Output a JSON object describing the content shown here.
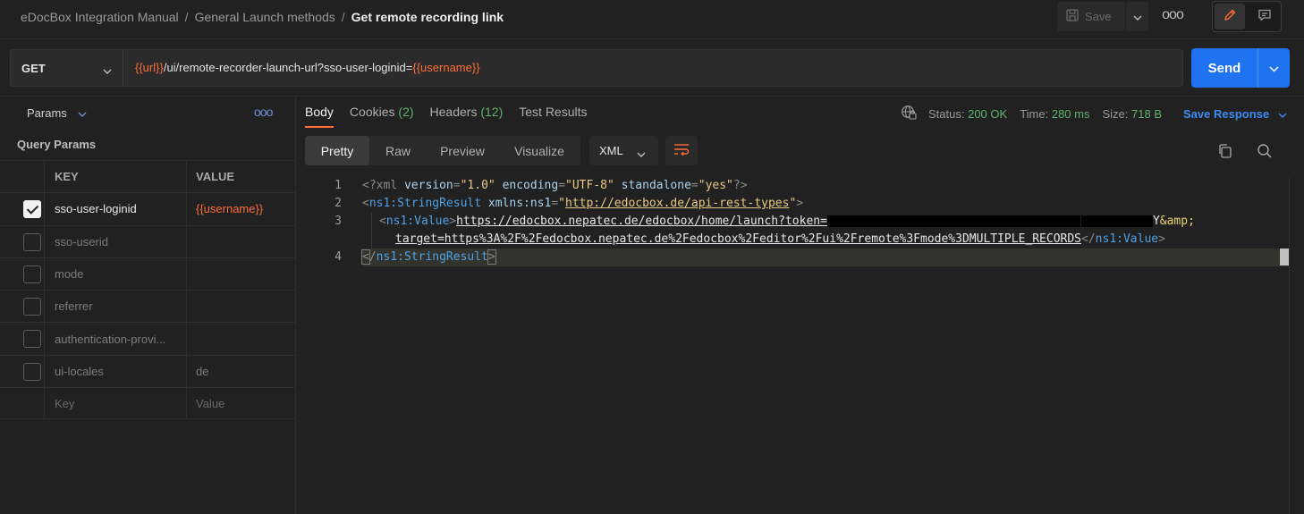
{
  "breadcrumb": {
    "items": [
      "eDocBox Integration Manual",
      "General Launch methods"
    ],
    "current": "Get remote recording link",
    "separator": "/"
  },
  "toolbar": {
    "save_label": "Save",
    "more_label": "ooo"
  },
  "request": {
    "method": "GET",
    "url_var1": "{{url}}",
    "url_path": "/ui/remote-recorder-launch-url?sso-user-loginid=",
    "url_var2": "{{username}}",
    "send_label": "Send"
  },
  "params_panel": {
    "tab_label": "Params",
    "more_label": "ooo",
    "section_title": "Query Params",
    "columns": [
      "KEY",
      "VALUE"
    ],
    "rows": [
      {
        "key": "sso-user-loginid",
        "value": "{{username}}",
        "checked": true
      },
      {
        "key": "sso-userid",
        "value": "",
        "checked": false
      },
      {
        "key": "mode",
        "value": "",
        "checked": false
      },
      {
        "key": "referrer",
        "value": "",
        "checked": false
      },
      {
        "key": "authentication-provi...",
        "value": "",
        "checked": false
      },
      {
        "key": "ui-locales",
        "value": "de",
        "checked": false
      }
    ],
    "placeholder": {
      "key": "Key",
      "value": "Value"
    }
  },
  "response": {
    "tabs": [
      {
        "label": "Body",
        "count": ""
      },
      {
        "label": "Cookies",
        "count": "(2)"
      },
      {
        "label": "Headers",
        "count": "(12)"
      },
      {
        "label": "Test Results",
        "count": ""
      }
    ],
    "status_label": "Status:",
    "status_value": "200 OK",
    "time_label": "Time:",
    "time_value": "280 ms",
    "size_label": "Size:",
    "size_value": "718 B",
    "save_response": "Save Response",
    "views": [
      "Pretty",
      "Raw",
      "Preview",
      "Visualize"
    ],
    "format": "XML"
  },
  "code": {
    "line_numbers": [
      "1",
      "2",
      "3",
      "4"
    ],
    "l1": {
      "open": "<?xml ",
      "a1": "version",
      "v1": "\"1.0\"",
      "a2": "encoding",
      "v2": "\"UTF-8\"",
      "a3": "standalone",
      "v3": "\"yes\"",
      "close": "?>"
    },
    "l2": {
      "tag": "ns1:StringResult",
      "attr": "xmlns:ns1",
      "val_link": "http://edocbox.de/api-rest-types"
    },
    "l3": {
      "tag": "ns1:Value",
      "text": "https://edocbox.nepatec.de/edocbox/home/launch?token=",
      "tail": "Y",
      "entity": "&amp;"
    },
    "l3b": {
      "text": "target=https%3A%2F%2Fedocbox.nepatec.de%2Fedocbox%2Feditor%2Fui%2Fremote%3Fmode%3DMULTIPLE_RECORDS",
      "close_tag": "ns1:Value"
    },
    "l4": {
      "close_tag": "ns1:StringResult"
    }
  },
  "colors": {
    "accent": "#ff6c37",
    "send": "#1f72f0",
    "status_ok": "#5fb36a",
    "link": "#3d8bf2"
  }
}
